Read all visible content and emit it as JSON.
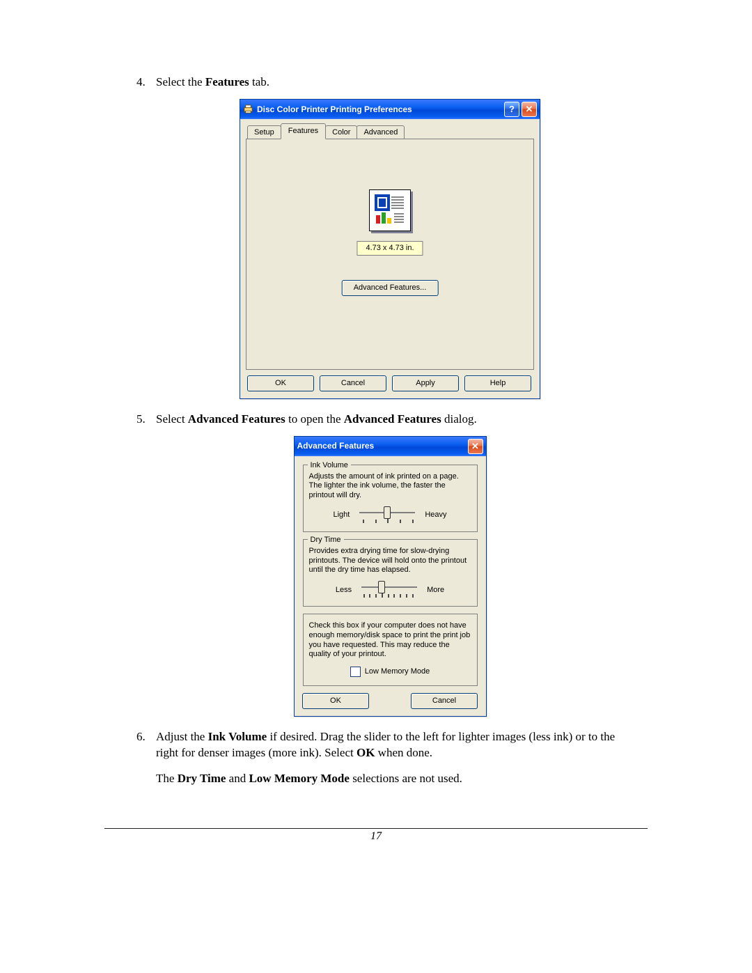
{
  "steps": {
    "s4": {
      "num": "4.",
      "prefix": "Select the ",
      "bold": "Features",
      "suffix": " tab."
    },
    "s5": {
      "num": "5.",
      "prefix": "Select ",
      "bold1": "Advanced Features",
      "mid": " to open the ",
      "bold2": "Advanced Features",
      "suffix": " dialog."
    },
    "s6": {
      "num": "6.",
      "t1": "Adjust the ",
      "b1": "Ink Volume",
      "t2": " if desired. Drag the slider to the left for lighter images (less ink) or to the right for denser images (more ink).  Select ",
      "b2": "OK",
      "t3": " when done.",
      "p2a": "The ",
      "p2b1": "Dry Time",
      "p2mid": " and ",
      "p2b2": "Low Memory Mode",
      "p2c": " selections are not used."
    }
  },
  "prefs_dialog": {
    "title": "Disc Color Printer Printing Preferences",
    "tabs": {
      "setup": "Setup",
      "features": "Features",
      "color": "Color",
      "advanced": "Advanced"
    },
    "size_label": "4.73 x 4.73 in.",
    "adv_features_btn": "Advanced Features...",
    "buttons": {
      "ok": "OK",
      "cancel": "Cancel",
      "apply": "Apply",
      "help": "Help"
    },
    "help_glyph": "?",
    "close_glyph": "✕"
  },
  "adv_dialog": {
    "title": "Advanced Features",
    "close_glyph": "✕",
    "ink": {
      "legend": "Ink Volume",
      "desc": "Adjusts the amount of ink printed on a page. The lighter the ink volume, the faster the printout will dry.",
      "left": "Light",
      "right": "Heavy"
    },
    "dry": {
      "legend": "Dry Time",
      "desc": "Provides extra drying time for slow-drying printouts. The device will hold onto the printout until the dry time has elapsed.",
      "left": "Less",
      "right": "More"
    },
    "mem": {
      "desc": "Check this box if your computer does not have enough memory/disk space to print the print job you have requested. This may reduce the quality of your printout.",
      "label": "Low Memory Mode"
    },
    "buttons": {
      "ok": "OK",
      "cancel": "Cancel"
    }
  },
  "page_number": "17"
}
